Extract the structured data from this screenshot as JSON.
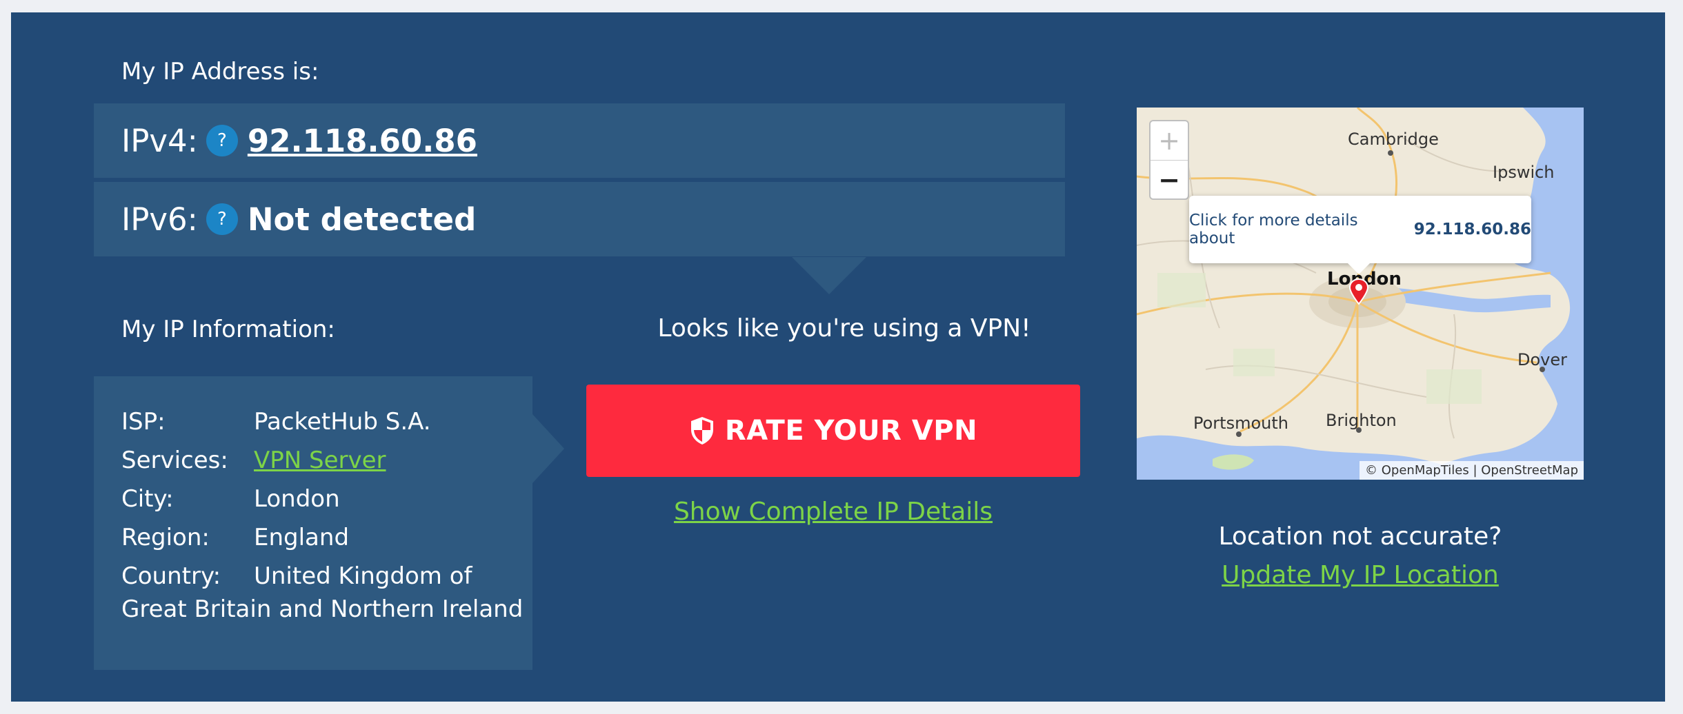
{
  "header": {
    "title": "My IP Address is:"
  },
  "ipv4": {
    "label": "IPv4:",
    "help": "?",
    "value": "92.118.60.86"
  },
  "ipv6": {
    "label": "IPv6:",
    "help": "?",
    "value": "Not detected"
  },
  "info": {
    "heading": "My IP Information:",
    "rows": [
      {
        "key": "ISP:",
        "value": "PacketHub S.A."
      },
      {
        "key": "Services:",
        "value": "VPN Server"
      },
      {
        "key": "City:",
        "value": "London"
      },
      {
        "key": "Region:",
        "value": "England"
      },
      {
        "key": "Country:",
        "value": "United Kingdom of"
      }
    ],
    "country_line2": "Great Britain and Northern Ireland"
  },
  "vpn": {
    "message": "Looks like you're using a VPN!",
    "button_label": "RATE YOUR VPN",
    "details_link": "Show Complete IP Details"
  },
  "map": {
    "zoom_in": "+",
    "zoom_out": "−",
    "popup_text": "Click for more details about",
    "popup_ip": "92.118.60.86",
    "cities": {
      "cambridge": "Cambridge",
      "ipswich": "Ipswich",
      "london": "London",
      "dover": "Dover",
      "portsmouth": "Portsmouth",
      "brighton": "Brighton"
    },
    "attribution": "© OpenMapTiles | OpenStreetMap"
  },
  "location": {
    "question": "Location not accurate?",
    "update_link": "Update My IP Location"
  },
  "colors": {
    "panel": "#224a76",
    "box": "#2e5980",
    "accent_red": "#fe2a3e",
    "link_green": "#7dd447",
    "help_blue": "#1c85c6"
  }
}
